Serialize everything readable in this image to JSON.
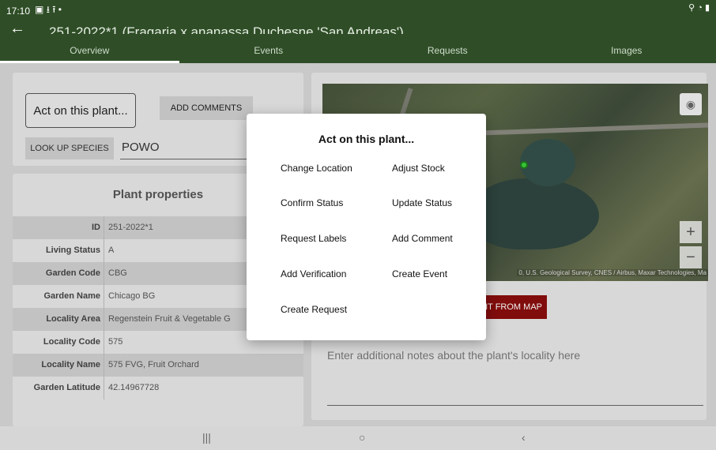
{
  "status": {
    "time": "17:10",
    "left_icons": "▣ ⭳ ⭱ •",
    "right_icons": "⚲ ◔ ▮"
  },
  "header": {
    "back_icon": "arrow-left-icon",
    "title": "251-2022*1 (Fragaria x ananassa Duchesne 'San Andreas')",
    "tabs": [
      {
        "label": "Overview",
        "active": true
      },
      {
        "label": "Events",
        "active": false
      },
      {
        "label": "Requests",
        "active": false
      },
      {
        "label": "Images",
        "active": false
      }
    ]
  },
  "actions_card": {
    "act_button": "Act on this plant...",
    "add_comments": "ADD COMMENTS",
    "look_up_species": "LOOK UP SPECIES",
    "species_source": "POWO"
  },
  "properties": {
    "title": "Plant properties",
    "rows": [
      {
        "key": "ID",
        "value": "251-2022*1"
      },
      {
        "key": "Living Status",
        "value": "A"
      },
      {
        "key": "Garden Code",
        "value": "CBG"
      },
      {
        "key": "Garden Name",
        "value": "Chicago BG"
      },
      {
        "key": "Locality Area",
        "value": "Regenstein Fruit & Vegetable G"
      },
      {
        "key": "Locality Code",
        "value": "575"
      },
      {
        "key": "Locality Name",
        "value": "575 FVG, Fruit Orchard"
      },
      {
        "key": "Garden Latitude",
        "value": "42.14967728"
      }
    ]
  },
  "map": {
    "attribution": "0, U.S. Geological Survey, CNES / Airbus, Maxar Technologies, Ma",
    "zoom_in": "+",
    "zoom_out": "−",
    "locate_icon": "◉",
    "set_point_button": "IT FROM MAP"
  },
  "notes": {
    "placeholder": "Enter additional notes about the plant's locality here"
  },
  "modal": {
    "title": "Act on this plant...",
    "actions": [
      "Change Location",
      "Adjust Stock",
      "Confirm Status",
      "Update Status",
      "Request Labels",
      "Add Comment",
      "Add Verification",
      "Create Event",
      "Create Request"
    ]
  },
  "navbar": {
    "recents": "|||",
    "home": "○",
    "back": "‹"
  }
}
